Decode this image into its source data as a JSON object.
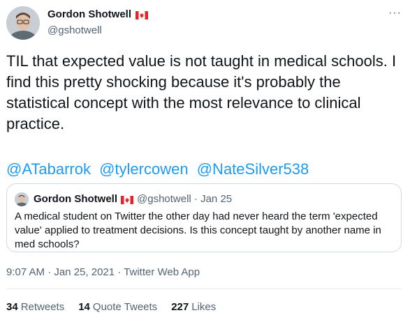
{
  "author": {
    "display_name": "Gordon Shotwell",
    "handle": "@gshotwell",
    "flag_icon": "canada-flag-icon"
  },
  "more_label": "···",
  "tweet_text": "TIL that expected value is not taught in medical schools. I find this pretty shocking because it's probably the statistical concept with the most relevance to clinical practice.",
  "mentions": [
    "@ATabarrok",
    "@tylercowen",
    "@NateSilver538"
  ],
  "quoted_tweet": {
    "display_name": "Gordon Shotwell",
    "meta": "@gshotwell · Jan 25",
    "text": "A medical student on Twitter the other day had never heard the term 'expected value' applied to treatment decisions. Is this concept taught by another name in med schools?"
  },
  "timestamp": "9:07 AM · Jan 25, 2021 · Twitter Web App",
  "stats": {
    "retweets": {
      "count": "34",
      "label": "Retweets"
    },
    "quote_tweets": {
      "count": "14",
      "label": "Quote Tweets"
    },
    "likes": {
      "count": "227",
      "label": "Likes"
    }
  },
  "colors": {
    "link": "#1d9bf0",
    "secondary_text": "#536471",
    "primary_text": "#0f1419",
    "border": "#cfd9de"
  }
}
